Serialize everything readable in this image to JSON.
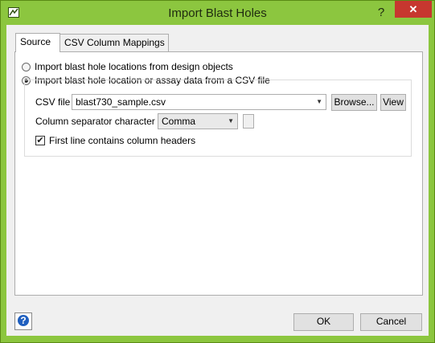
{
  "window": {
    "title": "Import Blast Holes",
    "help_glyph": "?",
    "close_glyph": "✕"
  },
  "tabs": [
    {
      "label": "Source",
      "active": true
    },
    {
      "label": "CSV Column Mappings",
      "active": false
    }
  ],
  "source": {
    "option_design": "Import blast hole locations from design objects",
    "option_csv": "Import blast hole location or assay data from a CSV file",
    "csv_file_label": "CSV file",
    "csv_file_value": "blast730_sample.csv",
    "browse_label": "Browse...",
    "view_label": "View",
    "separator_label": "Column separator character",
    "separator_value": "Comma",
    "header_checkbox_label": "First line contains column headers",
    "header_checkbox_checked": true
  },
  "footer": {
    "ok_label": "OK",
    "cancel_label": "Cancel"
  },
  "colors": {
    "titlebar": "#8cc63f",
    "close": "#c7372f",
    "help_icon": "#1f5fbf"
  },
  "icons": [
    "app-icon",
    "close-icon",
    "dropdown-arrow-icon",
    "help-icon",
    "checkmark-icon"
  ]
}
